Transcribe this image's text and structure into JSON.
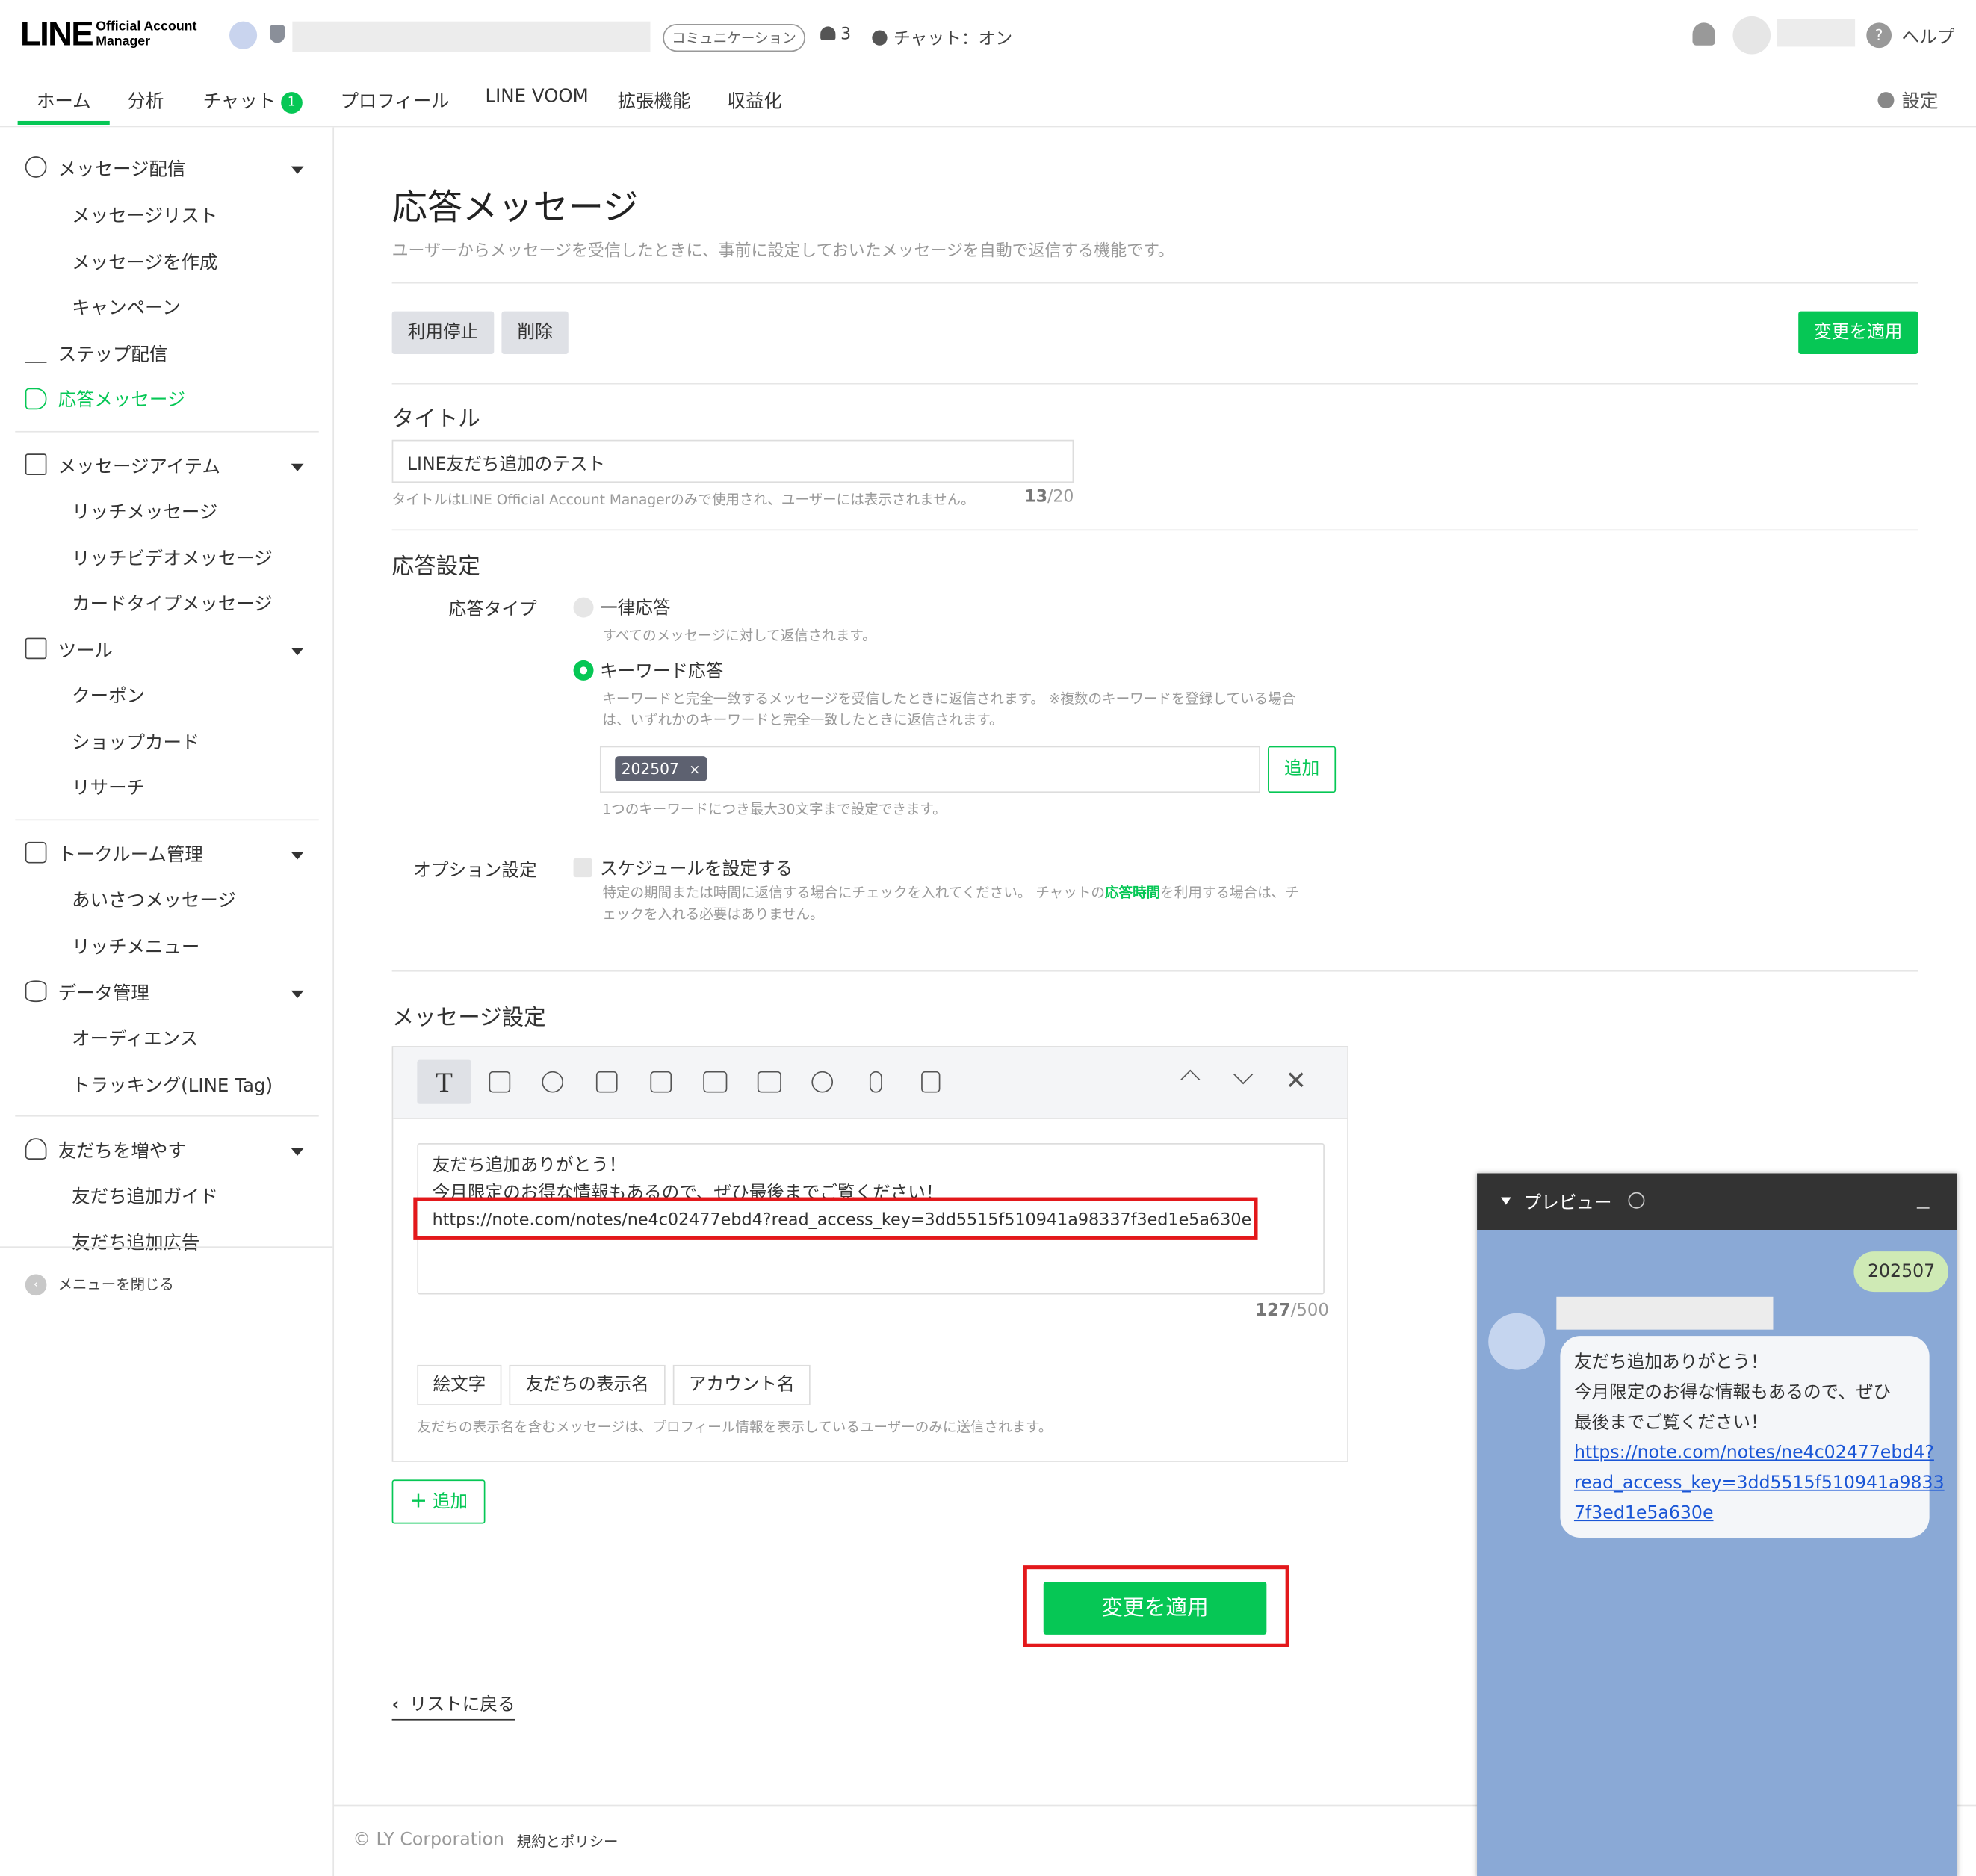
{
  "header": {
    "logo_main": "LINE",
    "logo_sub1": "Official Account",
    "logo_sub2": "Manager",
    "plan_badge": "コミュニケーション",
    "member_count": "3",
    "chat_status": "チャット：オン",
    "help": "ヘルプ"
  },
  "nav": {
    "tabs": [
      "ホーム",
      "分析",
      "チャット",
      "プロフィール",
      "LINE VOOM",
      "拡張機能",
      "収益化"
    ],
    "chat_badge": "1",
    "settings": "設定"
  },
  "sidebar": {
    "message_delivery": "メッセージ配信",
    "message_list": "メッセージリスト",
    "create_message": "メッセージを作成",
    "campaign": "キャンペーン",
    "step_delivery": "ステップ配信",
    "auto_response": "応答メッセージ",
    "message_items": "メッセージアイテム",
    "rich_message": "リッチメッセージ",
    "rich_video": "リッチビデオメッセージ",
    "card_message": "カードタイプメッセージ",
    "tools": "ツール",
    "coupon": "クーポン",
    "shop_card": "ショップカード",
    "research": "リサーチ",
    "talkroom": "トークルーム管理",
    "greeting": "あいさつメッセージ",
    "rich_menu": "リッチメニュー",
    "data_mgmt": "データ管理",
    "audience": "オーディエンス",
    "tracking": "トラッキング(LINE Tag)",
    "add_friends": "友だちを増やす",
    "friend_guide": "友だち追加ガイド",
    "friend_ads": "友だち追加広告",
    "close_menu": "メニューを閉じる"
  },
  "main": {
    "title": "応答メッセージ",
    "description": "ユーザーからメッセージを受信したときに、事前に設定しておいたメッセージを自動で返信する機能です。",
    "stop_button": "利用停止",
    "delete_button": "削除",
    "apply_button": "変更を適用",
    "title_section": "タイトル",
    "title_value": "LINE友だち追加のテスト",
    "title_note": "タイトルはLINE Official Account Managerのみで使用され、ユーザーには表示されません。",
    "title_count": "13",
    "title_max": "/20",
    "response_section": "応答設定",
    "response_type_label": "応答タイプ",
    "uniform_option": "一律応答",
    "uniform_desc": "すべてのメッセージに対して返信されます。",
    "keyword_option": "キーワード応答",
    "keyword_desc1": "キーワードと完全一致するメッセージを受信したときに返信されます。 ※複数のキーワードを登録している場合",
    "keyword_desc2": "は、いずれかのキーワードと完全一致したときに返信されます。",
    "keyword_chip": "202507",
    "keyword_add": "追加",
    "keyword_note": "1つのキーワードにつき最大30文字まで設定できます。",
    "option_label": "オプション設定",
    "schedule_option": "スケジュールを設定する",
    "schedule_desc1_a": "特定の期間または時間に返信する場合にチェックを入れてください。 チャットの",
    "schedule_desc1_link": "応答時間",
    "schedule_desc1_b": "を利用する場合は、チ",
    "schedule_desc2": "ェックを入れる必要はありません。",
    "message_section": "メッセージ設定",
    "message_line1": "友だち追加ありがとう！",
    "message_line2": "今月限定のお得な情報もあるので、ぜひ最後までご覧ください！",
    "message_line3": "https://note.com/notes/ne4c02477ebd4?read_access_key=3dd5515f510941a98337f3ed1e5a630e",
    "message_count": "127",
    "message_max": "/500",
    "emoji_button": "絵文字",
    "friend_name_button": "友だちの表示名",
    "account_name_button": "アカウント名",
    "friend_name_note": "友だちの表示名を含むメッセージは、プロフィール情報を表示しているユーザーのみに送信されます。",
    "add_button": "追加",
    "apply_button_bottom": "変更を適用",
    "back_link": "リストに戻る"
  },
  "preview": {
    "title": "プレビュー",
    "user_bubble": "202507",
    "line1": "友だち追加ありがとう！",
    "line2": "今月限定のお得な情報もあるので、ぜひ",
    "line3": "最後までご覧ください！",
    "link1": "https://note.com/notes/ne4c02477ebd4?",
    "link2": "read_access_key=3dd5515f510941a9833",
    "link3": "7f3ed1e5a630e"
  },
  "footer": {
    "copyright": "© LY Corporation",
    "policy": "規約とポリシー"
  },
  "colors": {
    "brand": "#06c755",
    "highlight": "#e3181b",
    "preview_bg": "#8aa9d6"
  }
}
